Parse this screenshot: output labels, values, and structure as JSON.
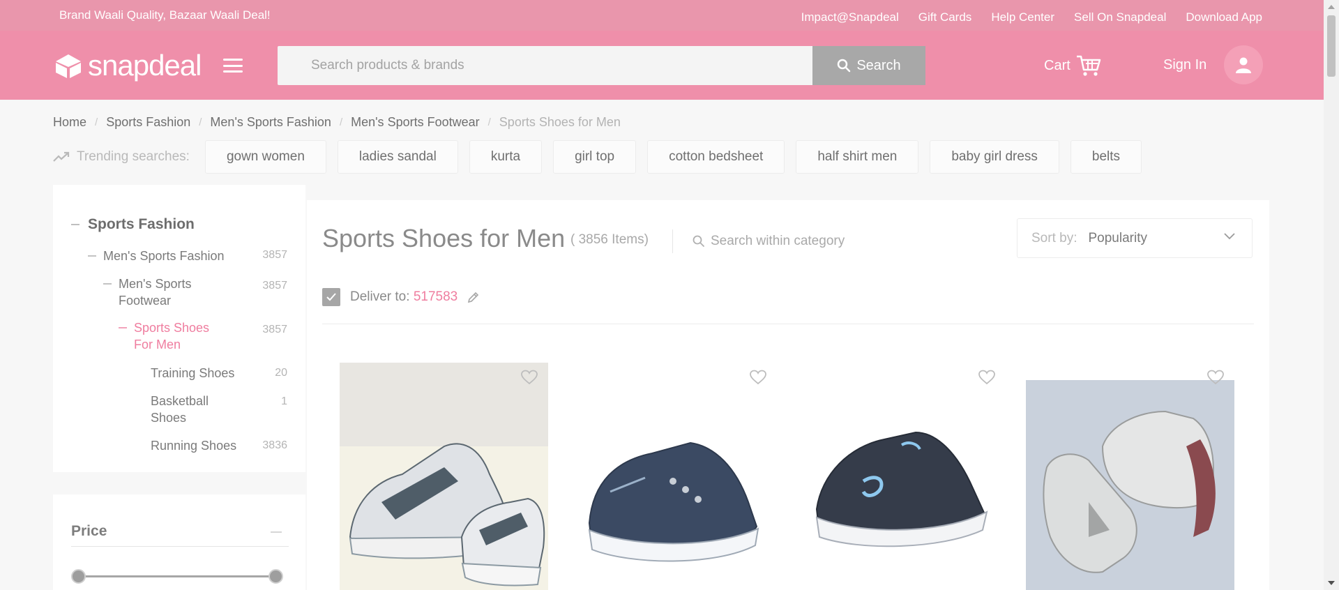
{
  "top_strip": {
    "tagline": "Brand Waali Quality, Bazaar Waali Deal!",
    "links": [
      "Impact@Snapdeal",
      "Gift Cards",
      "Help Center",
      "Sell On Snapdeal",
      "Download App"
    ]
  },
  "header": {
    "logo_text": "snapdeal",
    "search_placeholder": "Search products & brands",
    "search_button": "Search",
    "cart_label": "Cart",
    "signin_label": "Sign In"
  },
  "breadcrumb": [
    "Home",
    "Sports Fashion",
    "Men's Sports Fashion",
    "Men's Sports Footwear",
    "Sports Shoes for Men"
  ],
  "trending": {
    "label": "Trending searches:",
    "chips": [
      "gown women",
      "ladies sandal",
      "kurta",
      "girl top",
      "cotton bedsheet",
      "half shirt men",
      "baby girl dress",
      "belts"
    ]
  },
  "sidebar": {
    "root": "Sports Fashion",
    "categories": [
      {
        "label": "Men's Sports Fashion",
        "count": "3857"
      },
      {
        "label": "Men's Sports Footwear",
        "count": "3857"
      },
      {
        "label": "Sports Shoes For Men",
        "count": "3857"
      },
      {
        "label": "Training Shoes",
        "count": "20"
      },
      {
        "label": "Basketball Shoes",
        "count": "1"
      },
      {
        "label": "Running Shoes",
        "count": "3836"
      }
    ],
    "price_title": "Price"
  },
  "main": {
    "title": "Sports Shoes for Men",
    "item_count": "( 3856 Items)",
    "search_within": "Search within category",
    "sort_label": "Sort by:",
    "sort_value": "Popularity",
    "deliver_label": "Deliver to:",
    "pincode": "517583"
  },
  "colors": {
    "brand": "#e40046",
    "header_bg": "#ef8faa",
    "accent_link": "#ef7d9f"
  }
}
